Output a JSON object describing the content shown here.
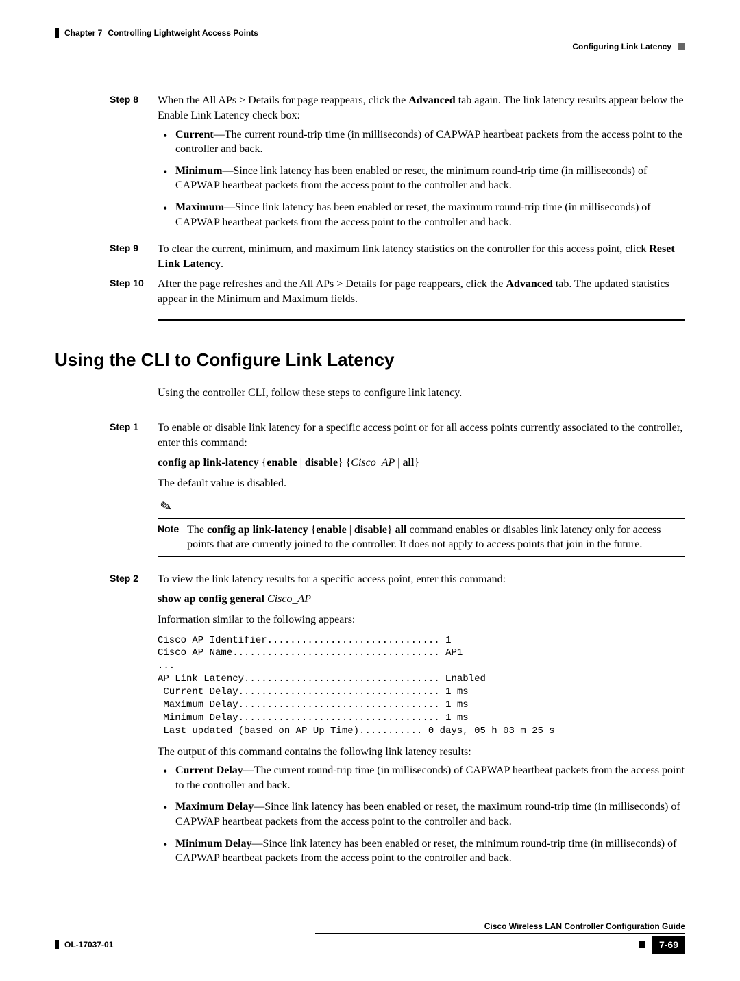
{
  "header": {
    "chapter": "Chapter 7",
    "title": "Controlling Lightweight Access Points",
    "section": "Configuring Link Latency"
  },
  "stepsA": {
    "step8": {
      "label": "Step 8",
      "intro_pre": "When the All APs > Details for page reappears, click the ",
      "intro_bold": "Advanced",
      "intro_post": " tab again. The link latency results appear below the Enable Link Latency check box:",
      "bullets": [
        {
          "term": "Current",
          "desc": "—The current round-trip time (in milliseconds) of CAPWAP heartbeat packets from the access point to the controller and back."
        },
        {
          "term": "Minimum",
          "desc": "—Since link latency has been enabled or reset, the minimum round-trip time (in milliseconds) of CAPWAP heartbeat packets from the access point to the controller and back."
        },
        {
          "term": "Maximum",
          "desc": "—Since link latency has been enabled or reset, the maximum round-trip time (in milliseconds) of CAPWAP heartbeat packets from the access point to the controller and back."
        }
      ]
    },
    "step9": {
      "label": "Step 9",
      "pre": "To clear the current, minimum, and maximum link latency statistics on the controller for this access point, click ",
      "bold": "Reset Link Latency",
      "post": "."
    },
    "step10": {
      "label": "Step 10",
      "pre": "After the page refreshes and the All APs > Details for page reappears, click the ",
      "bold": "Advanced",
      "post": " tab. The updated statistics appear in the Minimum and Maximum fields."
    }
  },
  "heading": "Using the CLI to Configure Link Latency",
  "intro": "Using the controller CLI, follow these steps to configure link latency.",
  "stepsB": {
    "step1": {
      "label": "Step 1",
      "text": "To enable or disable link latency for a specific access point or for all access points currently associated to the controller, enter this command:",
      "cmd_b1": "config ap link-latency",
      "cmd_p1": " {",
      "cmd_b2": "enable",
      "cmd_p2": " | ",
      "cmd_b3": "disable",
      "cmd_p3": "} {",
      "cmd_i1": "Cisco_AP",
      "cmd_p4": " | ",
      "cmd_b4": "all",
      "cmd_p5": "}",
      "default": "The default value is disabled.",
      "note_label": "Note",
      "note_pre": "The ",
      "note_b1": "config ap link-latency",
      "note_p1": " {",
      "note_b2": "enable",
      "note_p2": " | ",
      "note_b3": "disable",
      "note_p3": "} ",
      "note_b4": "all",
      "note_post": " command enables or disables link latency only for access points that are currently joined to the controller. It does not apply to access points that join in the future."
    },
    "step2": {
      "label": "Step 2",
      "text": "To view the link latency results for a specific access point, enter this command:",
      "cmd_b": "show ap config general",
      "cmd_i": " Cisco_AP",
      "info": "Information similar to the following appears:",
      "code": "Cisco AP Identifier.............................. 1\nCisco AP Name.................................... AP1\n...\nAP Link Latency.................................. Enabled\n Current Delay................................... 1 ms\n Maximum Delay................................... 1 ms\n Minimum Delay................................... 1 ms\n Last updated (based on AP Up Time)........... 0 days, 05 h 03 m 25 s",
      "outp": "The output of this command contains the following link latency results:",
      "bullets": [
        {
          "term": "Current Delay",
          "desc": "—The current round-trip time (in milliseconds) of CAPWAP heartbeat packets from the access point to the controller and back."
        },
        {
          "term": "Maximum Delay",
          "desc": "—Since link latency has been enabled or reset, the maximum round-trip time (in milliseconds) of CAPWAP heartbeat packets from the access point to the controller and back."
        },
        {
          "term": "Minimum Delay",
          "desc": "—Since link latency has been enabled or reset, the minimum round-trip time (in milliseconds) of CAPWAP heartbeat packets from the access point to the controller and back."
        }
      ]
    }
  },
  "footer": {
    "guide": "Cisco Wireless LAN Controller Configuration Guide",
    "docnum": "OL-17037-01",
    "page": "7-69"
  }
}
